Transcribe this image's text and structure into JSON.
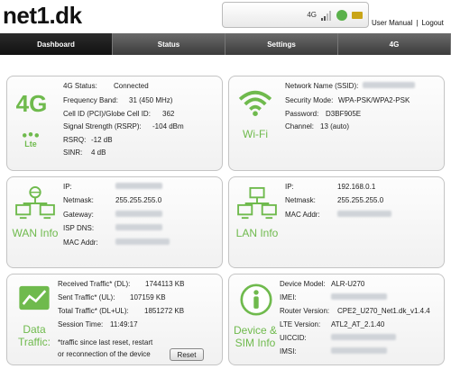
{
  "brand": {
    "logo": "net1.dk"
  },
  "status_bar": {
    "network": "4G"
  },
  "top_links": {
    "user_manual": "User Manual",
    "separator": "|",
    "logout": "Logout"
  },
  "nav": {
    "tabs": [
      {
        "label": "Dashboard"
      },
      {
        "label": "Status"
      },
      {
        "label": "Settings"
      },
      {
        "label": "4G"
      }
    ]
  },
  "panel_4g": {
    "label": "4G",
    "icon_label": "Lte",
    "rows": [
      {
        "label": "4G Status:",
        "value": "Connected"
      },
      {
        "label": "Frequency Band:",
        "value": "31 (450 MHz)"
      },
      {
        "label": "Cell ID (PCI)/Globe Cell ID:",
        "value": "362"
      },
      {
        "label": "Signal Strength (RSRP):",
        "value": "-104 dBm"
      },
      {
        "label": "RSRQ:",
        "value": "-12 dB"
      },
      {
        "label": "SINR:",
        "value": "4 dB"
      }
    ]
  },
  "panel_wifi": {
    "label": "Wi-Fi",
    "rows": [
      {
        "label": "Network Name (SSID):",
        "value": ""
      },
      {
        "label": "Security Mode:",
        "value": "WPA-PSK/WPA2-PSK"
      },
      {
        "label": "Password:",
        "value": "D3BF905E"
      },
      {
        "label": "Channel:",
        "value": "13 (auto)"
      }
    ]
  },
  "panel_wan": {
    "label": "WAN Info",
    "rows": [
      {
        "label": "IP:",
        "value": ""
      },
      {
        "label": "Netmask:",
        "value": "255.255.255.0"
      },
      {
        "label": "Gateway:",
        "value": ""
      },
      {
        "label": "ISP DNS:",
        "value": ""
      },
      {
        "label": "MAC Addr:",
        "value": ""
      }
    ]
  },
  "panel_lan": {
    "label": "LAN Info",
    "rows": [
      {
        "label": "IP:",
        "value": "192.168.0.1"
      },
      {
        "label": "Netmask:",
        "value": "255.255.255.0"
      },
      {
        "label": "MAC Addr:",
        "value": ""
      }
    ]
  },
  "panel_data": {
    "label_line1": "Data",
    "label_line2": "Traffic:",
    "rows": [
      {
        "label": "Received Traffic* (DL):",
        "value": "1744113 KB"
      },
      {
        "label": "Sent Traffic* (UL):",
        "value": "107159 KB"
      },
      {
        "label": "Total Traffic* (DL+UL):",
        "value": "1851272 KB"
      },
      {
        "label": "Session Time:",
        "value": "11:49:17"
      }
    ],
    "note_line1": "*traffic since last reset, restart",
    "note_line2": "or reconnection of the device",
    "reset_label": "Reset"
  },
  "panel_device": {
    "label_line1": "Device &",
    "label_line2": "SIM Info",
    "rows": [
      {
        "label": "Device Model:",
        "value": "ALR-U270"
      },
      {
        "label": "IMEI:",
        "value": ""
      },
      {
        "label": "Router Version:",
        "value": "CPE2_U270_Net1.dk_v1.4.4"
      },
      {
        "label": "LTE Version:",
        "value": "ATL2_AT_2.1.40"
      },
      {
        "label": "UICCID:",
        "value": ""
      },
      {
        "label": "IMSI:",
        "value": ""
      }
    ]
  },
  "colors": {
    "accent_green": "#6fba4d",
    "nav_bg": "#4a4a4a",
    "nav_active": "#1a1a1a"
  }
}
